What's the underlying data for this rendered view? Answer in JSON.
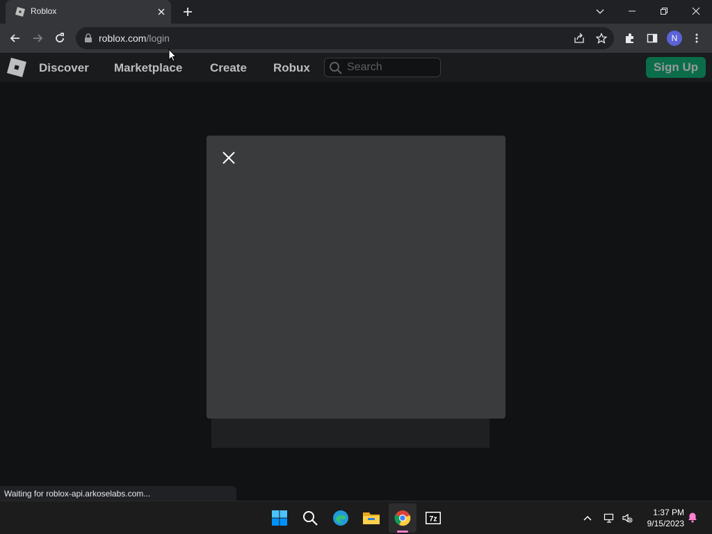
{
  "browser": {
    "tab": {
      "title": "Roblox"
    },
    "url": {
      "domain": "roblox.com",
      "path": "/login"
    },
    "profile_initial": "N"
  },
  "header": {
    "nav": [
      "Discover",
      "Marketplace",
      "Create",
      "Robux"
    ],
    "search_placeholder": "Search",
    "signup_label": "Sign Up"
  },
  "status_text": "Waiting for roblox-api.arkoselabs.com...",
  "taskbar": {
    "time": "1:37 PM",
    "date": "9/15/2023",
    "accent_color": "#ff7fd1"
  },
  "colors": {
    "signup_green": "#00b06f",
    "modal_bg": "#393b3d",
    "page_bg": "#111214"
  }
}
